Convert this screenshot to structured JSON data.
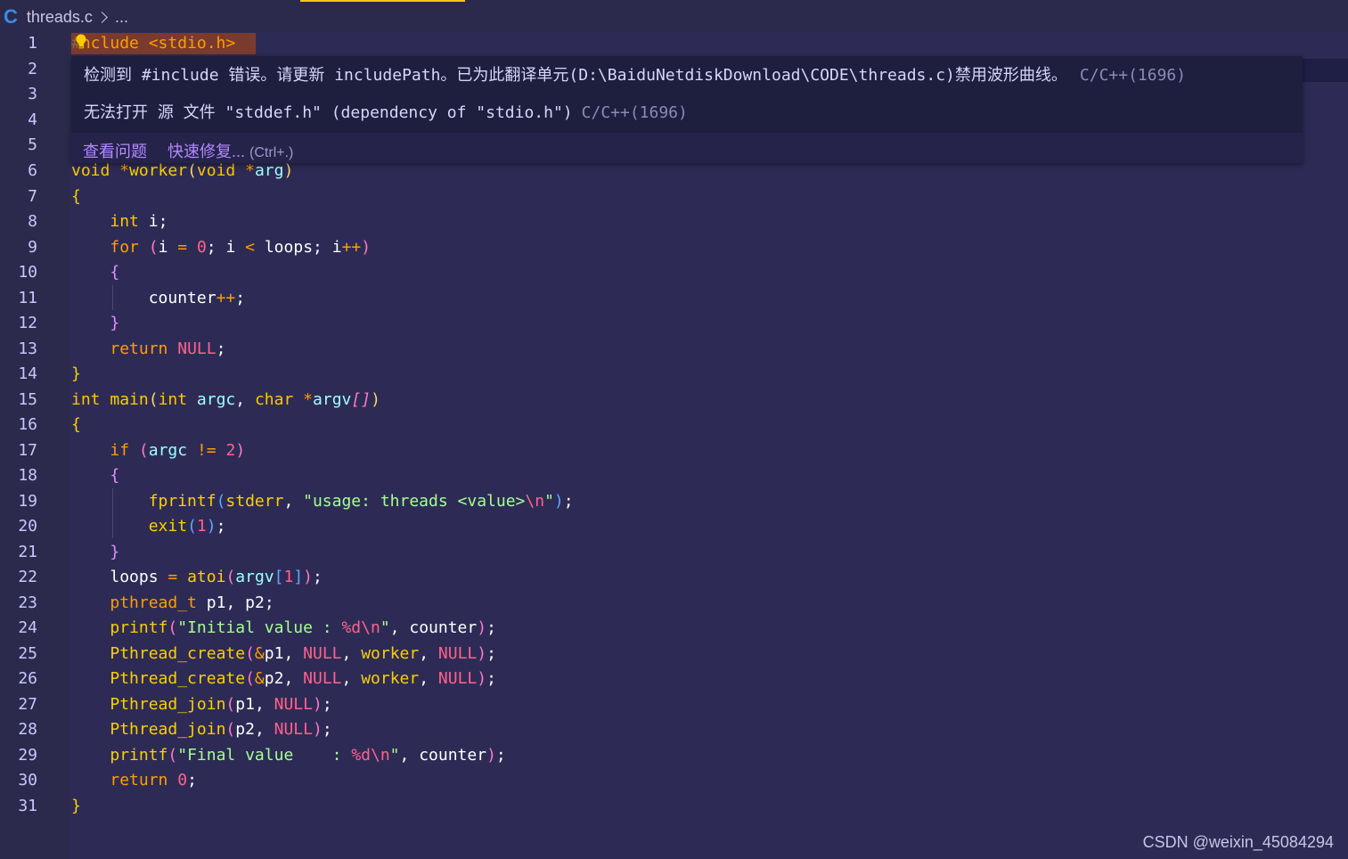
{
  "breadcrumb": {
    "file_icon": "C",
    "file_name": "threads.c",
    "more": "..."
  },
  "gutter": {
    "line_numbers": [
      "1",
      "2",
      "3",
      "4",
      "5",
      "6",
      "7",
      "8",
      "9",
      "10",
      "11",
      "12",
      "13",
      "14",
      "15",
      "16",
      "17",
      "18",
      "19",
      "20",
      "21",
      "22",
      "23",
      "24",
      "25",
      "26",
      "27",
      "28",
      "29",
      "30",
      "31"
    ]
  },
  "code": {
    "line1_hash": "#",
    "line1_text": "nclude <stdio.h>"
  },
  "hover": {
    "diag1_text": "检测到 #include 错误。请更新 includePath。已为此翻译单元(D:\\BaiduNetdiskDownload\\CODE\\threads.c)禁用波形曲线。",
    "diag1_source": "C/C++(1696)",
    "diag2_text": "无法打开 源 文件 \"stddef.h\" (dependency of \"stdio.h\")",
    "diag2_source": "C/C++(1696)",
    "view_problem": "查看问题",
    "quick_fix": "快速修复...",
    "quick_fix_shortcut": "(Ctrl+.)"
  },
  "watermark": "CSDN @weixin_45084294",
  "icons": {
    "file_lang": "c-language-icon",
    "lightbulb": "lightbulb-icon",
    "breadcrumb_sep": "chevron-right-icon"
  },
  "colors": {
    "editor_bg": "#2d2b55",
    "accent": "#f9c513",
    "keyword": "#ff9d00",
    "string": "#a5ff90",
    "link": "#b388ff"
  }
}
